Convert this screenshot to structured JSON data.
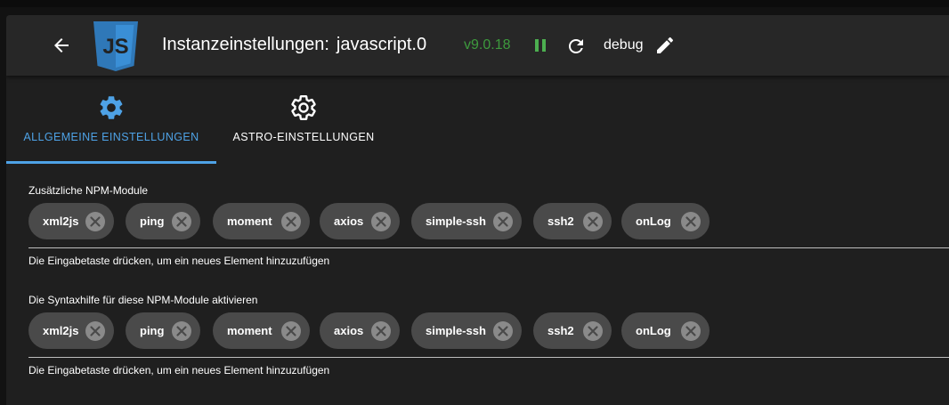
{
  "header": {
    "title": "Instanzeinstellungen:",
    "instance": "javascript.0",
    "version": "v9.0.18",
    "log_level": "debug",
    "logo_text": "JS",
    "colors": {
      "version": "#3d9a3d",
      "pause": "#4caf50",
      "logo": "#3a8fd6"
    },
    "icons": {
      "back": "arrow-left-icon",
      "pause": "pause-icon",
      "reload": "reload-icon",
      "edit": "pencil-icon"
    }
  },
  "tabs": [
    {
      "label": "ALLGEMEINE EINSTELLUNGEN",
      "icon": "gear-icon",
      "active": true
    },
    {
      "label": "ASTRO-EINSTELLUNGEN",
      "icon": "gear-outline-icon",
      "active": false
    }
  ],
  "accent_color": "#4ea2e6",
  "fields": [
    {
      "label": "Zusätzliche NPM-Module",
      "chips": [
        "xml2js",
        "ping",
        "moment",
        "axios",
        "simple-ssh",
        "ssh2",
        "onLog"
      ],
      "helper": "Die Eingabetaste drücken, um ein neues Element hinzuzufügen"
    },
    {
      "label": "Die Syntaxhilfe für diese NPM-Module aktivieren",
      "chips": [
        "xml2js",
        "ping",
        "moment",
        "axios",
        "simple-ssh",
        "ssh2",
        "onLog"
      ],
      "helper": "Die Eingabetaste drücken, um ein neues Element hinzuzufügen"
    }
  ]
}
